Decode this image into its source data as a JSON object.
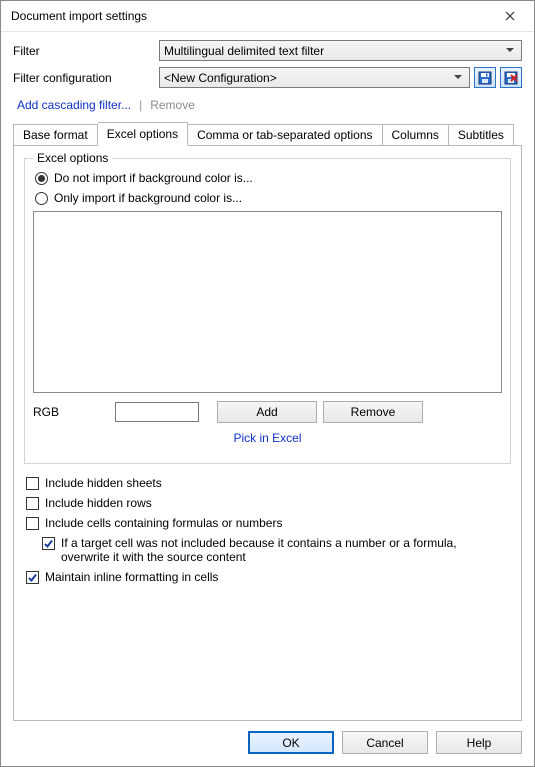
{
  "window": {
    "title": "Document import settings"
  },
  "filter": {
    "label": "Filter",
    "value": "Multilingual delimited text filter"
  },
  "filter_config": {
    "label": "Filter configuration",
    "value": "<New Configuration>"
  },
  "links": {
    "add_cascading": "Add cascading filter...",
    "remove": "Remove"
  },
  "tabs": {
    "base_format": "Base format",
    "excel_options": "Excel options",
    "csv_options": "Comma or tab-separated options",
    "columns": "Columns",
    "subtitles": "Subtitles"
  },
  "group": {
    "title": "Excel options",
    "radio_do_not": "Do not import if background color is...",
    "radio_only": "Only import if background color is...",
    "rgb_label": "RGB",
    "rgb_value": "",
    "add_btn": "Add",
    "remove_btn": "Remove",
    "pick": "Pick in Excel"
  },
  "checks": {
    "hidden_sheets": "Include hidden sheets",
    "hidden_rows": "Include hidden rows",
    "cells_formulas": "Include cells containing formulas or numbers",
    "overwrite_note": "If a target cell was not included because it contains a number or a formula, overwrite it with the source content",
    "maintain_inline": "Maintain inline formatting in cells"
  },
  "footer": {
    "ok": "OK",
    "cancel": "Cancel",
    "help": "Help"
  }
}
